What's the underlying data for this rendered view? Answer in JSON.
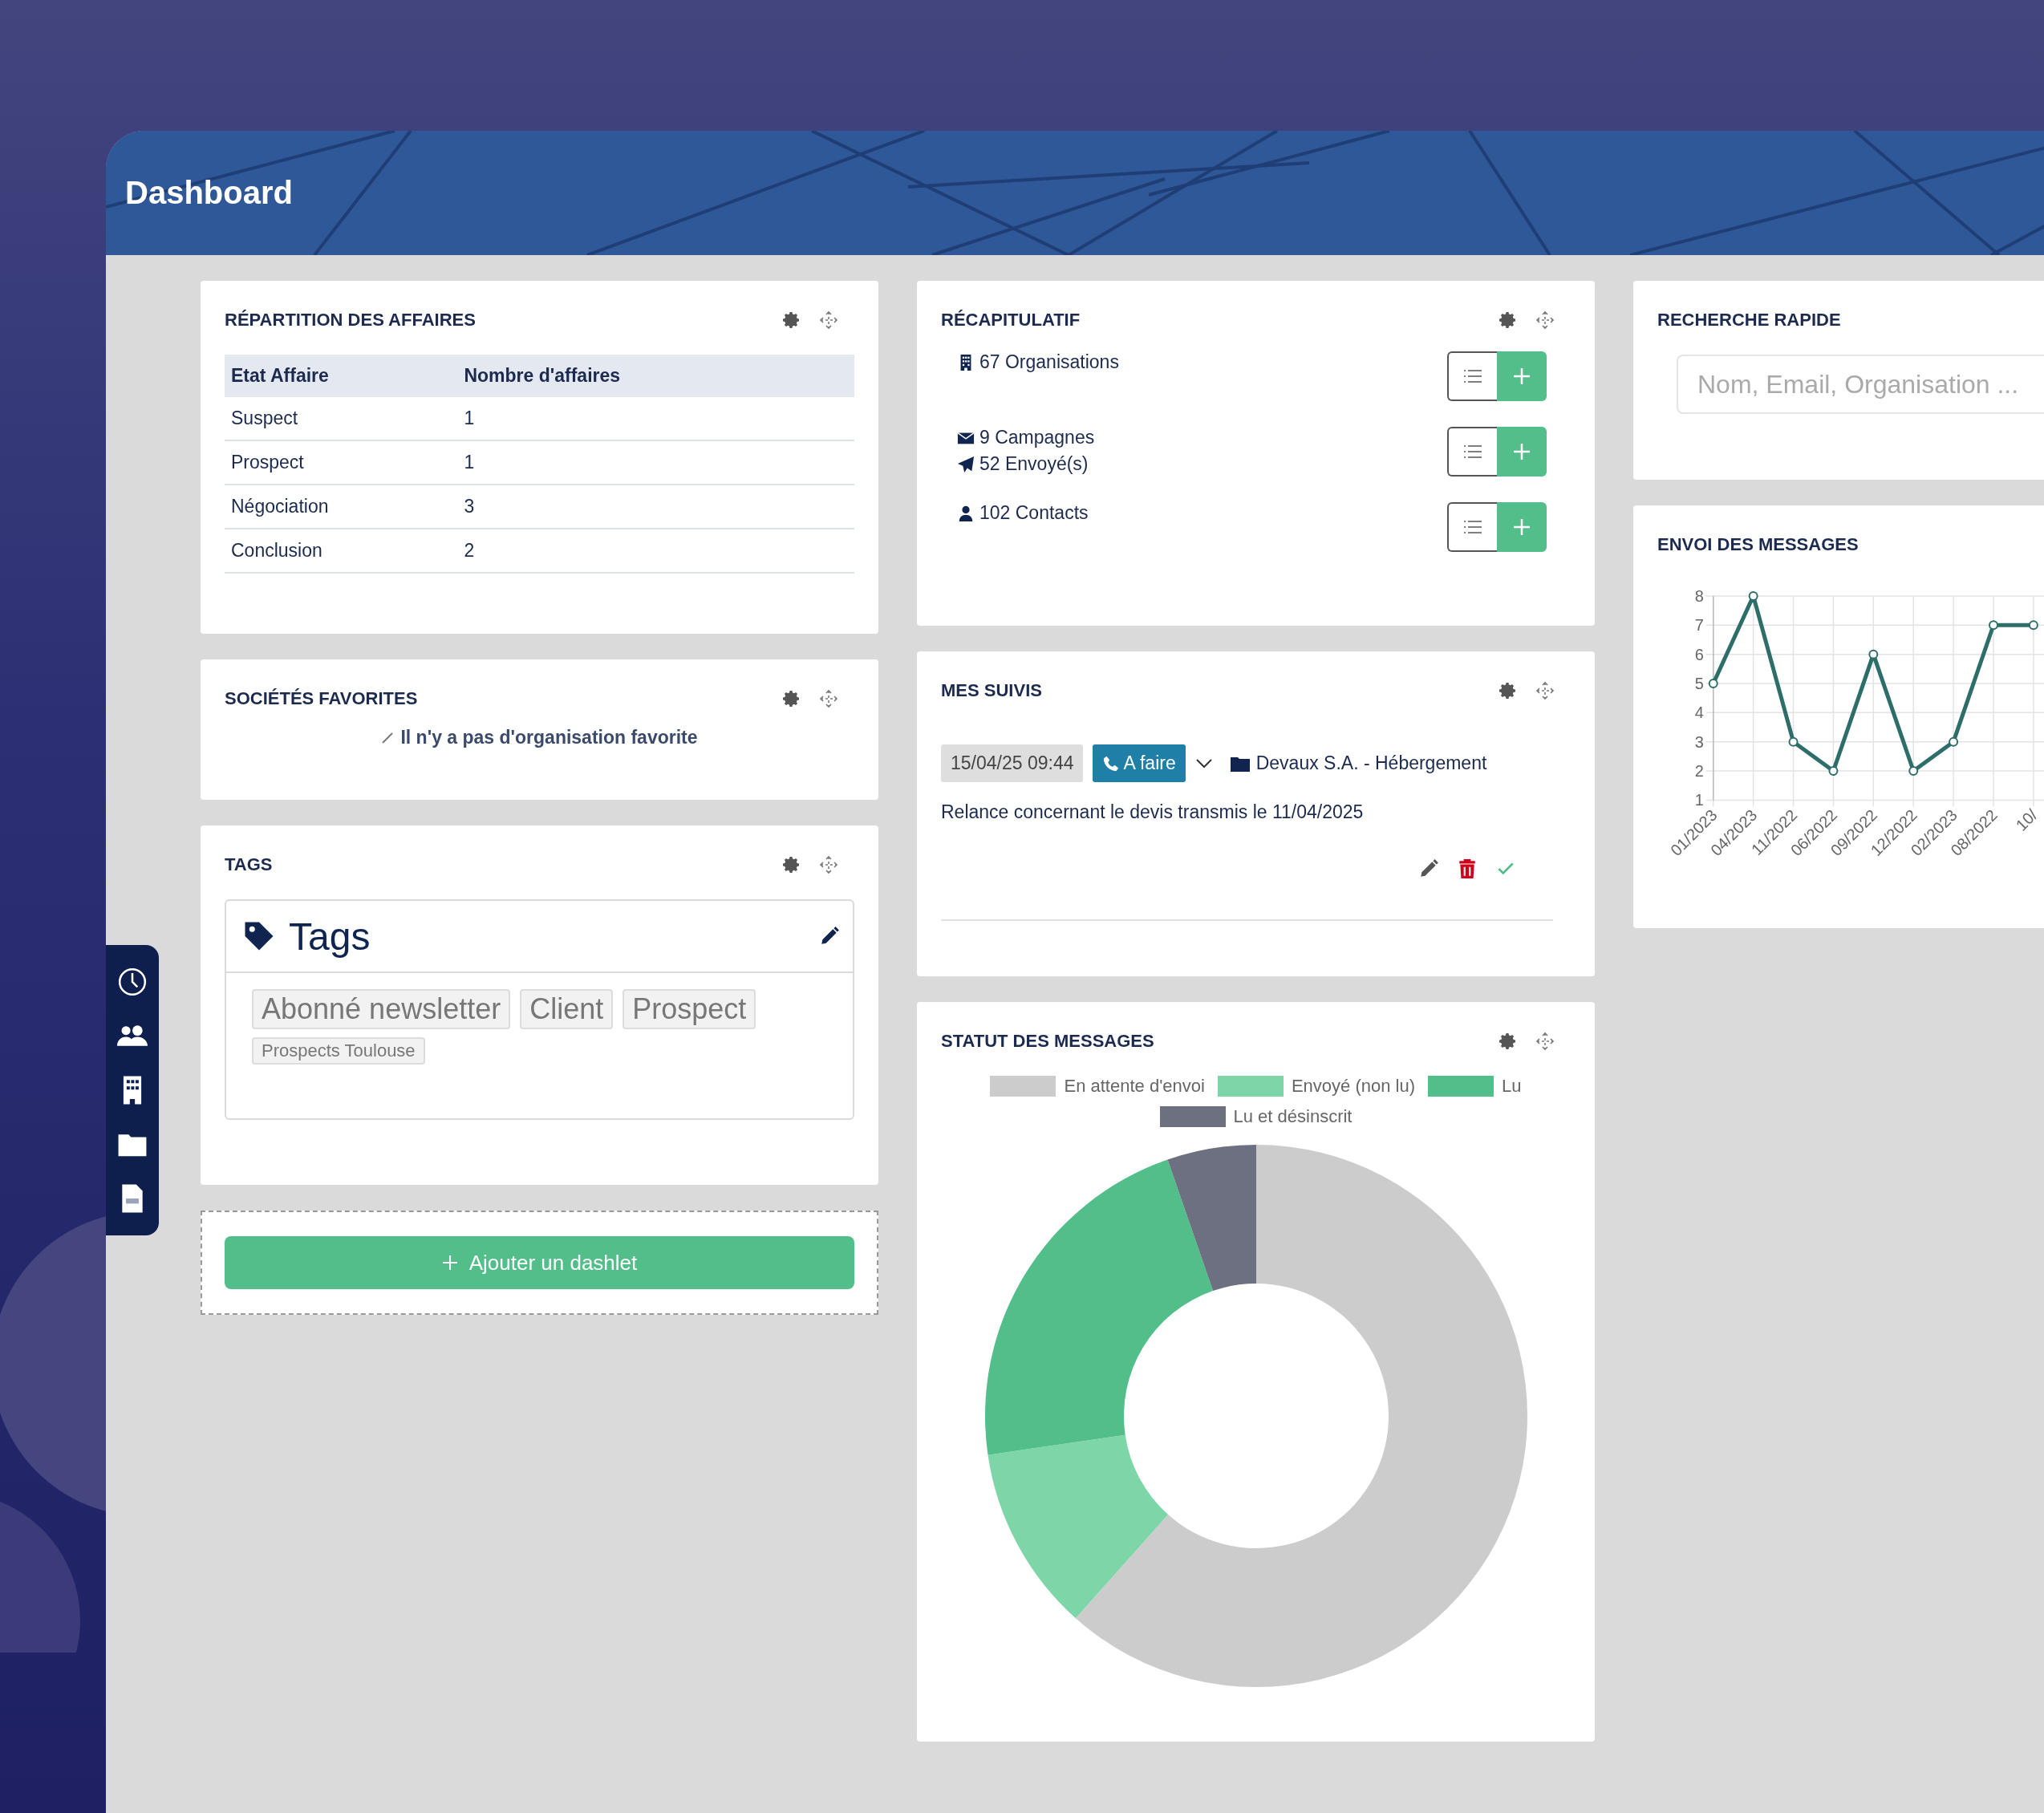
{
  "header": {
    "title": "Dashboard"
  },
  "repartition": {
    "title": "RÉPARTITION DES AFFAIRES",
    "columns": [
      "Etat Affaire",
      "Nombre d'affaires"
    ],
    "rows": [
      [
        "Suspect",
        "1"
      ],
      [
        "Prospect",
        "1"
      ],
      [
        "Négociation",
        "3"
      ],
      [
        "Conclusion",
        "2"
      ]
    ]
  },
  "favorites": {
    "title": "SOCIÉTÉS FAVORITES",
    "message": "Il n'y a pas d'organisation favorite"
  },
  "tags": {
    "title": "TAGS",
    "box_title": "Tags",
    "tags": [
      {
        "label": "Abonné newsletter",
        "kind": "large"
      },
      {
        "label": "Client",
        "kind": "large"
      },
      {
        "label": "Prospect",
        "kind": "large"
      },
      {
        "label": "Prospects Toulouse",
        "kind": "small"
      }
    ]
  },
  "add_dashlet": {
    "label": "Ajouter un dashlet"
  },
  "recap": {
    "title": "RÉCAPITULATIF",
    "groups": [
      {
        "lines": [
          {
            "kind": "building",
            "text": "67 Organisations"
          }
        ]
      },
      {
        "lines": [
          {
            "kind": "envelope",
            "text": "9 Campagnes"
          },
          {
            "kind": "plane",
            "text": "52 Envoyé(s)"
          }
        ]
      },
      {
        "lines": [
          {
            "kind": "person",
            "text": "102 Contacts"
          }
        ]
      }
    ]
  },
  "suivis": {
    "title": "MES SUIVIS",
    "items": [
      {
        "date": "15/04/25 09:44",
        "status": "A faire",
        "target": "Devaux S.A. - Hébergement",
        "description": "Relance concernant le devis transmis le 11/04/2025"
      }
    ]
  },
  "statut": {
    "title": "STATUT DES MESSAGES",
    "legend": [
      {
        "label": "En attente d'envoi",
        "color": "#cccccc"
      },
      {
        "label": "Envoyé (non lu)",
        "color": "#7dd6a8"
      },
      {
        "label": "Lu",
        "color": "#52be8a"
      },
      {
        "label": "Lu et désinscrit",
        "color": "#6c7080"
      }
    ]
  },
  "search": {
    "title": "RECHERCHE RAPIDE",
    "placeholder": "Nom, Email, Organisation ..."
  },
  "envoi": {
    "title": "ENVOI DES MESSAGES",
    "chart_data": {
      "type": "line",
      "categories": [
        "01/2023",
        "04/2023",
        "11/2022",
        "06/2022",
        "09/2022",
        "12/2022",
        "02/2023",
        "08/2022",
        "10/"
      ],
      "series": [
        {
          "color": "#2e6e6a",
          "marker": true,
          "values": [
            5,
            8,
            3,
            2,
            6,
            2,
            3,
            7,
            7
          ]
        }
      ],
      "grid": true,
      "ylim": [
        1,
        8
      ],
      "yticks": [
        1,
        2,
        3,
        4,
        5,
        6,
        7,
        8
      ]
    }
  }
}
